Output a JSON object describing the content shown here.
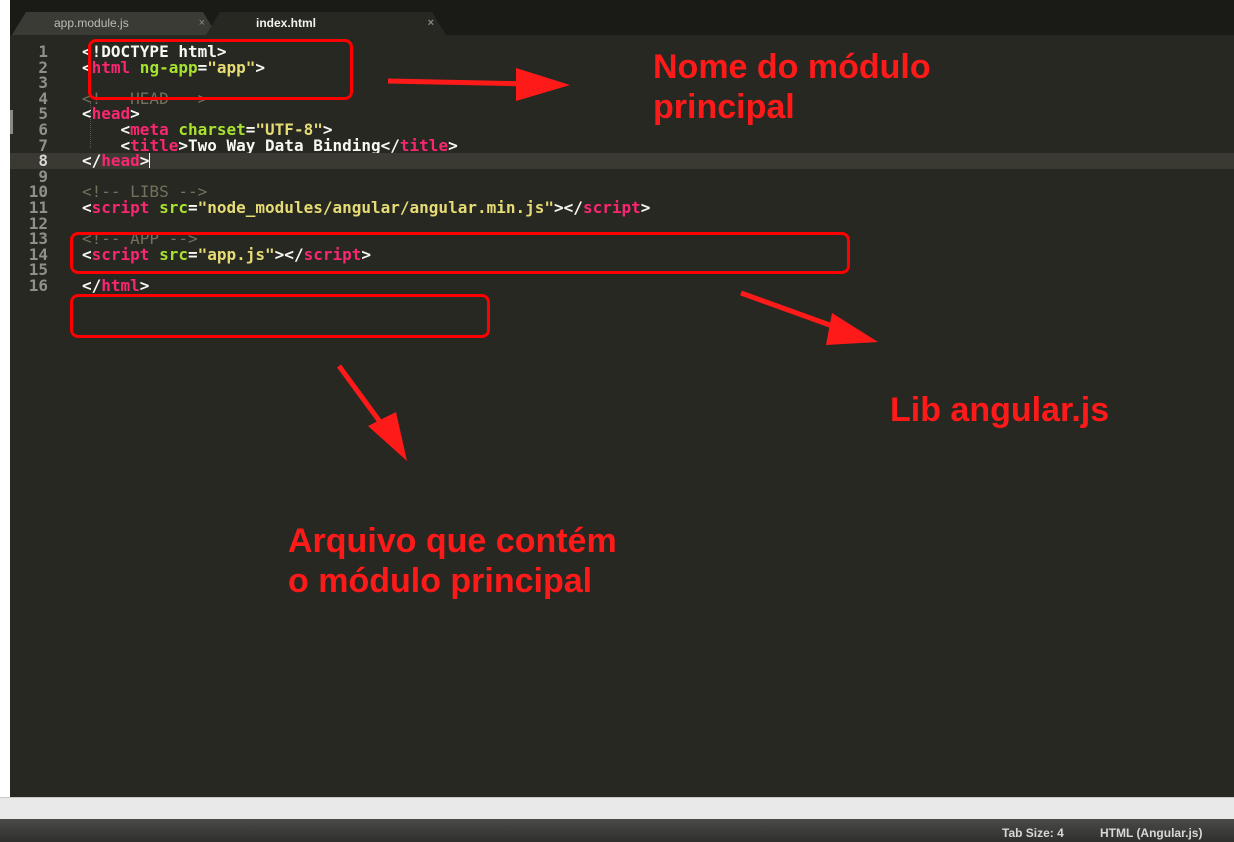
{
  "tabs": [
    {
      "label": "app.module.js",
      "close": "×",
      "active": false
    },
    {
      "label": "index.html",
      "close": "×",
      "active": true
    }
  ],
  "code_lines": [
    {
      "num": "1",
      "tokens": [
        {
          "t": "<!DOCTYPE html>",
          "c": "plain"
        }
      ]
    },
    {
      "num": "2",
      "tokens": [
        {
          "t": "<",
          "c": "plain"
        },
        {
          "t": "html",
          "c": "tag"
        },
        {
          "t": " ng-app",
          "c": "attr"
        },
        {
          "t": "=",
          "c": "plain"
        },
        {
          "t": "\"app\"",
          "c": "str"
        },
        {
          "t": ">",
          "c": "plain"
        }
      ]
    },
    {
      "num": "3",
      "tokens": []
    },
    {
      "num": "4",
      "tokens": [
        {
          "t": "<!-- HEAD -->",
          "c": "com"
        }
      ]
    },
    {
      "num": "5",
      "tokens": [
        {
          "t": "<",
          "c": "plain"
        },
        {
          "t": "head",
          "c": "tag"
        },
        {
          "t": ">",
          "c": "plain"
        }
      ]
    },
    {
      "num": "6",
      "tokens": [
        {
          "t": "    <",
          "c": "plain"
        },
        {
          "t": "meta",
          "c": "tag"
        },
        {
          "t": " charset",
          "c": "attr"
        },
        {
          "t": "=",
          "c": "plain"
        },
        {
          "t": "\"UTF-8\"",
          "c": "str"
        },
        {
          "t": ">",
          "c": "plain"
        }
      ]
    },
    {
      "num": "7",
      "tokens": [
        {
          "t": "    <",
          "c": "plain"
        },
        {
          "t": "title",
          "c": "tag"
        },
        {
          "t": ">Two Way Data Binding</",
          "c": "plain"
        },
        {
          "t": "title",
          "c": "tag"
        },
        {
          "t": ">",
          "c": "plain"
        }
      ]
    },
    {
      "num": "8",
      "tokens": [
        {
          "t": "</",
          "c": "plain"
        },
        {
          "t": "head",
          "c": "tag"
        },
        {
          "t": ">",
          "c": "plain"
        }
      ],
      "current": true
    },
    {
      "num": "9",
      "tokens": []
    },
    {
      "num": "10",
      "tokens": [
        {
          "t": "<!-- LIBS -->",
          "c": "com"
        }
      ]
    },
    {
      "num": "11",
      "tokens": [
        {
          "t": "<",
          "c": "plain"
        },
        {
          "t": "script",
          "c": "tag"
        },
        {
          "t": " src",
          "c": "attr"
        },
        {
          "t": "=",
          "c": "plain"
        },
        {
          "t": "\"node_modules/angular/angular.min.js\"",
          "c": "str"
        },
        {
          "t": "></",
          "c": "plain"
        },
        {
          "t": "script",
          "c": "tag"
        },
        {
          "t": ">",
          "c": "plain"
        }
      ]
    },
    {
      "num": "12",
      "tokens": []
    },
    {
      "num": "13",
      "tokens": [
        {
          "t": "<!-- APP -->",
          "c": "com"
        }
      ]
    },
    {
      "num": "14",
      "tokens": [
        {
          "t": "<",
          "c": "plain"
        },
        {
          "t": "script",
          "c": "tag"
        },
        {
          "t": " src",
          "c": "attr"
        },
        {
          "t": "=",
          "c": "plain"
        },
        {
          "t": "\"app.js\"",
          "c": "str"
        },
        {
          "t": "></",
          "c": "plain"
        },
        {
          "t": "script",
          "c": "tag"
        },
        {
          "t": ">",
          "c": "plain"
        }
      ]
    },
    {
      "num": "15",
      "tokens": []
    },
    {
      "num": "16",
      "tokens": [
        {
          "t": "</",
          "c": "plain"
        },
        {
          "t": "html",
          "c": "tag"
        },
        {
          "t": ">",
          "c": "plain"
        }
      ]
    }
  ],
  "annotations": {
    "module_name": "Nome do módulo\nprincipal",
    "lib": "Lib angular.js",
    "app_file": "Arquivo que contém\no módulo principal"
  },
  "status": {
    "tab_size": "Tab Size: 4",
    "syntax": "HTML (Angular.js)"
  },
  "colors": {
    "background": "#272822",
    "tag": "#f92672",
    "attribute": "#a6e22e",
    "string": "#e6db74",
    "comment": "#75715e",
    "annotation": "#ff1a1a"
  }
}
